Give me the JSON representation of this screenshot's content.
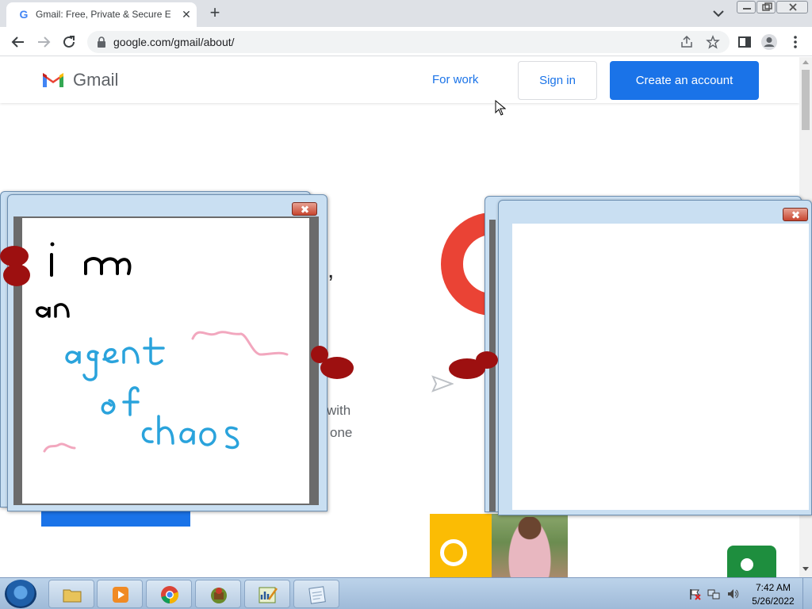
{
  "browser": {
    "tab_title": "Gmail: Free, Private & Secure Em",
    "favicon_letter": "G",
    "url": "google.com/gmail/about/"
  },
  "gmail": {
    "brand": "Gmail",
    "for_work": "For work",
    "sign_in": "Sign in",
    "create_account": "Create an account",
    "visible_fragments": [
      ",",
      "with",
      "one"
    ]
  },
  "paint_drawing": {
    "strokes": [
      "i m",
      "an",
      "agent",
      "of",
      "chaos"
    ]
  },
  "taskbar": {
    "time": "7:42 AM",
    "date": "5/26/2022",
    "apps": [
      "file-explorer",
      "media-player",
      "chrome",
      "game",
      "chart-editor",
      "notepad"
    ]
  },
  "colors": {
    "accent": "#1a73e8",
    "gmail_red": "#ea4335",
    "blob": "#9d1010",
    "drawing_blue": "#2aa3dc",
    "drawing_pink": "#f2a7be"
  }
}
